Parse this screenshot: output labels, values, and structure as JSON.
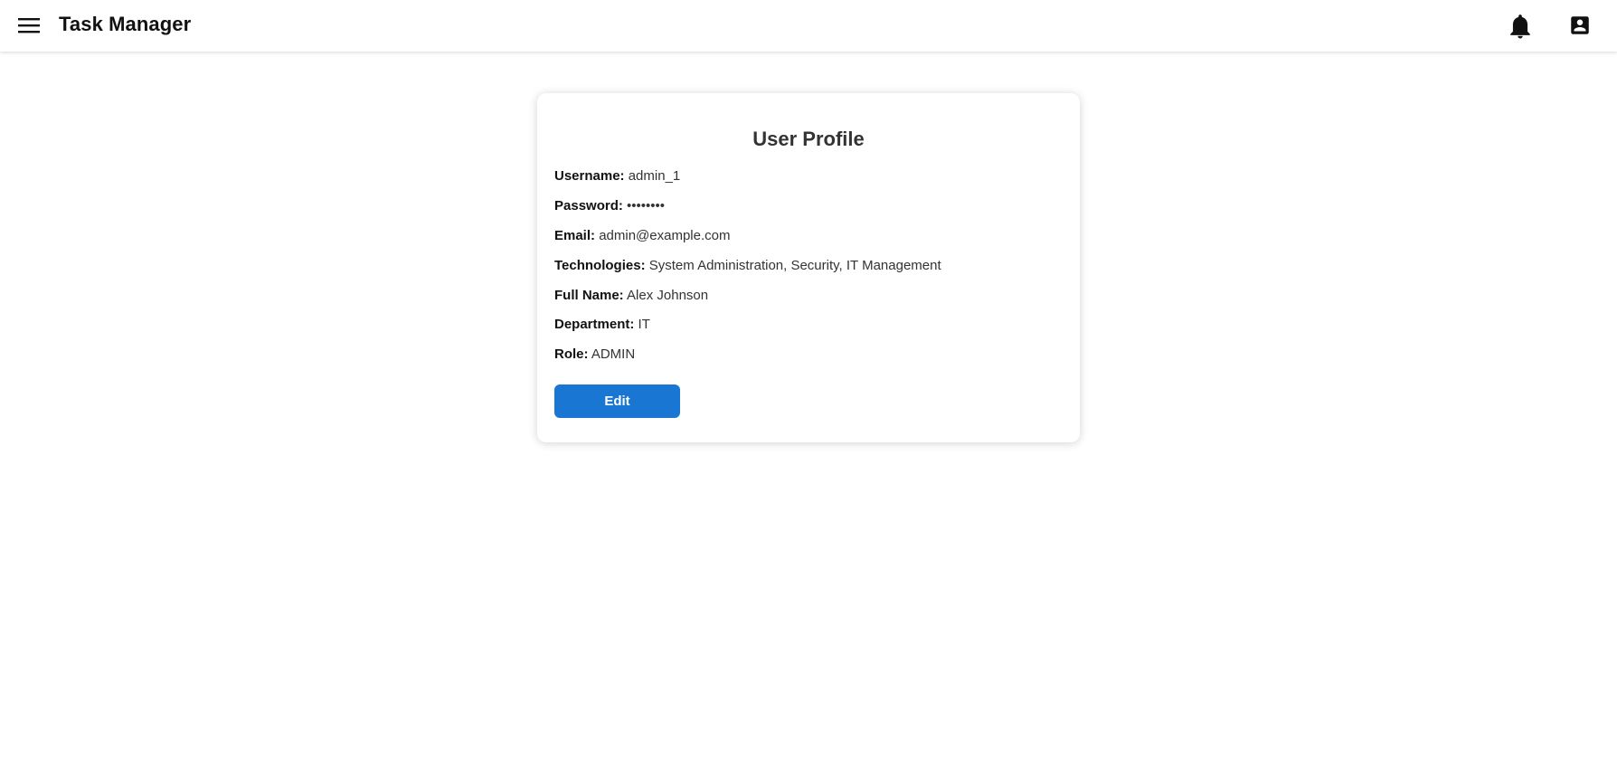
{
  "appbar": {
    "title": "Task Manager",
    "icons": {
      "menu": "menu-icon",
      "notifications": "bell-icon",
      "account": "account-box-icon"
    }
  },
  "profile": {
    "title": "User Profile",
    "fields": [
      {
        "label": "Username:",
        "value": "admin_1"
      },
      {
        "label": "Password:",
        "value": "••••••••"
      },
      {
        "label": "Email:",
        "value": "admin@example.com"
      },
      {
        "label": "Technologies:",
        "value": "System Administration, Security, IT Management"
      },
      {
        "label": "Full Name:",
        "value": "Alex Johnson"
      },
      {
        "label": "Department:",
        "value": "IT"
      },
      {
        "label": "Role:",
        "value": "ADMIN"
      }
    ],
    "edit_label": "Edit"
  },
  "colors": {
    "primary": "#1976d2",
    "appbar_background": "#ffffff",
    "title_text": "#111111",
    "card_title_text": "#333333"
  }
}
